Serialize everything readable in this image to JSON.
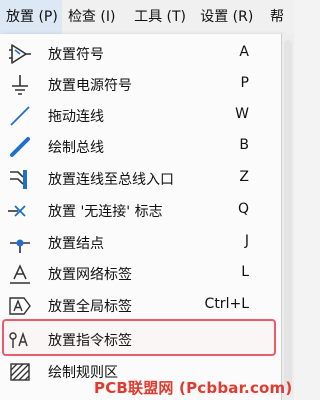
{
  "menubar": {
    "items": [
      {
        "label": "放置 (P)"
      },
      {
        "label": "检查 (I)"
      },
      {
        "label": "工具 (T)"
      },
      {
        "label": "设置 (R)"
      },
      {
        "label": "帮"
      }
    ]
  },
  "menu": {
    "items": [
      {
        "icon": "place-symbol-icon",
        "label": "放置符号",
        "shortcut": "A"
      },
      {
        "icon": "place-power-symbol-icon",
        "label": "放置电源符号",
        "shortcut": "P"
      },
      {
        "icon": "drag-wire-icon",
        "label": "拖动连线",
        "shortcut": "W"
      },
      {
        "icon": "draw-bus-icon",
        "label": "绘制总线",
        "shortcut": "B"
      },
      {
        "icon": "wire-to-bus-entry-icon",
        "label": "放置连线至总线入口",
        "shortcut": "Z"
      },
      {
        "icon": "no-connect-flag-icon",
        "label": "放置 '无连接' 标志",
        "shortcut": "Q"
      },
      {
        "icon": "junction-icon",
        "label": "放置结点",
        "shortcut": "J"
      },
      {
        "icon": "net-label-icon",
        "label": "放置网络标签",
        "shortcut": "L"
      },
      {
        "icon": "global-label-icon",
        "label": "放置全局标签",
        "shortcut": "Ctrl+L"
      },
      {
        "icon": "directive-label-icon",
        "label": "放置指令标签",
        "shortcut": ""
      },
      {
        "icon": "rule-area-icon",
        "label": "绘制规则区",
        "shortcut": ""
      }
    ]
  },
  "watermark": {
    "text": "PCB联盟网 (Pcbbar.com)"
  },
  "colors": {
    "highlight": "#ec5a6e",
    "icon_blue": "#1f6fd1",
    "watermark": "#e33a2f"
  }
}
